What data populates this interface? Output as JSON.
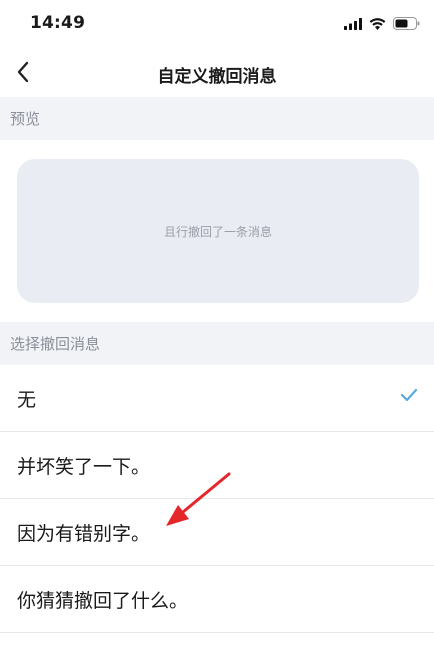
{
  "status_bar": {
    "time": "14:49"
  },
  "nav": {
    "title": "自定义撤回消息"
  },
  "preview": {
    "header": "预览",
    "message": "且行撤回了一条消息"
  },
  "options": {
    "header": "选择撤回消息",
    "items": [
      {
        "label": "无",
        "selected": true
      },
      {
        "label": "并坏笑了一下。",
        "selected": false
      },
      {
        "label": "因为有错别字。",
        "selected": false
      },
      {
        "label": "你猜猜撤回了什么。",
        "selected": false
      }
    ]
  },
  "colors": {
    "accent_check": "#5aa8e0",
    "annotation_arrow": "#e5262b",
    "section_bg": "#f2f3f7",
    "preview_card_bg": "#e9ecf3"
  },
  "icons": {
    "back": "chevron-left-icon",
    "check": "checkmark-icon",
    "signal": "signal-icon",
    "wifi": "wifi-icon",
    "battery": "battery-icon"
  }
}
